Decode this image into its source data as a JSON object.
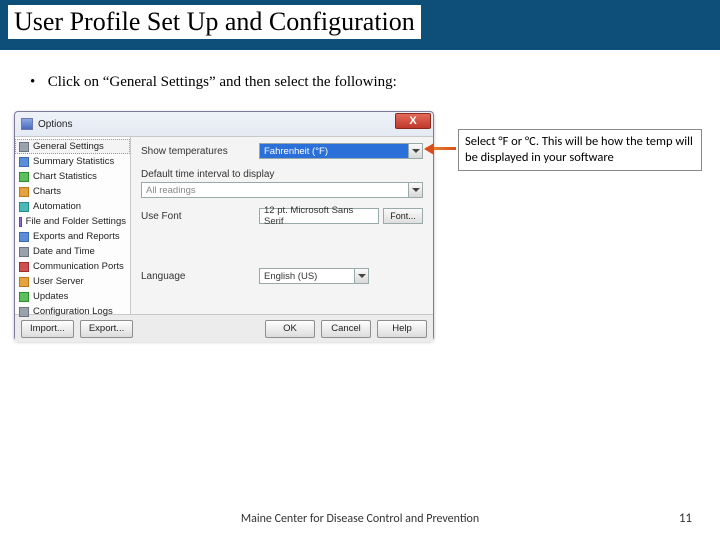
{
  "slide": {
    "title": "User Profile Set Up and Configuration",
    "bullet": "Click on “General Settings” and then select the following:"
  },
  "dialog": {
    "title": "Options",
    "close_glyph": "X",
    "sidebar": [
      {
        "label": "General Settings",
        "icon": "gray",
        "selected": true
      },
      {
        "label": "Summary Statistics",
        "icon": "blue"
      },
      {
        "label": "Chart Statistics",
        "icon": "green"
      },
      {
        "label": "Charts",
        "icon": "orange"
      },
      {
        "label": "Automation",
        "icon": "teal"
      },
      {
        "label": "File and Folder Settings",
        "icon": "purple"
      },
      {
        "label": "Exports and Reports",
        "icon": "blue"
      },
      {
        "label": "Date and Time",
        "icon": "gray"
      },
      {
        "label": "Communication Ports",
        "icon": "red"
      },
      {
        "label": "User Server",
        "icon": "orange"
      },
      {
        "label": "Updates",
        "icon": "green"
      },
      {
        "label": "Configuration Logs",
        "icon": "gray"
      }
    ],
    "fields": {
      "show_temps_label": "Show temperatures",
      "show_temps_value": "Fahrenheit (°F)",
      "interval_label": "Default time interval to display",
      "interval_value": "All readings",
      "font_label": "Use Font",
      "font_value": "12 pt. Microsoft Sans Serif",
      "font_button": "Font...",
      "language_label": "Language",
      "language_value": "English (US)"
    },
    "buttons": {
      "import": "Import...",
      "export": "Export...",
      "ok": "OK",
      "cancel": "Cancel",
      "help": "Help"
    }
  },
  "callout": "Select °F or °C. This will be how the temp will be displayed in your software",
  "footer": {
    "org": "Maine Center for Disease Control and Prevention",
    "page": "11"
  }
}
